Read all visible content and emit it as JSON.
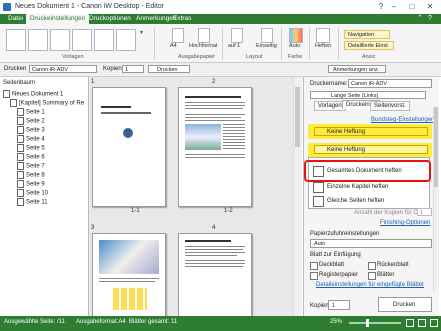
{
  "window": {
    "title": "Neues Dokument 1 - Canon iW Desktop - Editor"
  },
  "ribbon": {
    "tabs": [
      "Datei",
      "Druckeinstellungen",
      "Druckoptionen",
      "Anmerkungen",
      "Extras"
    ],
    "active_tab": "Druckeinstellungen",
    "groups": {
      "vorlagen": "Vorlagen",
      "ausgabepapier": "Ausgabepapier",
      "layout": "Layout",
      "farbe": "Farbe",
      "ansic": "Ansic"
    },
    "buttons": {
      "a4": "A4",
      "hochformat": "Hochformat",
      "auf1": "auf 1",
      "einseitig": "Einseitig",
      "auto": "Auto",
      "heften": "Heften",
      "navigation": "Navigation",
      "detaillierte_einst": "Detaillierte Einst"
    }
  },
  "toolbar": {
    "drucken_label": "Drucken",
    "printer": "Canon iR-ADV",
    "kopien_label": "Kopien",
    "kopien_value": "1",
    "drucken_button": "Drucken",
    "anmerkungen_button": "Anmerkungen anz."
  },
  "left_pane": {
    "header": "Seitenbaum",
    "root": "Neues Dokument 1",
    "chapter": "[Kapitel] Summary of Re",
    "pages": [
      "Seite 1",
      "Seite 2",
      "Seite 3",
      "Seite 4",
      "Seite 5",
      "Seite 6",
      "Seite 7",
      "Seite 8",
      "Seite 9",
      "Seite 10",
      "Seite 11"
    ]
  },
  "center": {
    "page_labels": [
      "1",
      "2",
      "3",
      "4"
    ],
    "spread_labels": [
      "1-1",
      "1-2"
    ]
  },
  "right_pane": {
    "druckername_label": "Druckername:",
    "druckername_value": "Canon iR-ADV",
    "top_combo": "Lange Seite (Links)",
    "tabs": [
      "Vorlagen",
      "Druckeinst.",
      "Seitenvorst."
    ],
    "active_tab": "Druckeinst.",
    "bundsteg_link": "Bundsteg-Einstellungen",
    "heften_combo_top": "Keine Heftung",
    "heften_combo": "Keine Heftung",
    "menu_items": [
      "Gesamtes Dokument heften",
      "Einzelne Kapitel heften",
      "Gleiche Seiten heften"
    ],
    "highlighted_item": "Gesamtes Dokument heften",
    "anzahl_label": "Anzahl der Kopien für Offset:",
    "anzahl_value": "1",
    "finishing_link": "Finishing-Optionen",
    "papierzufuhr_label": "Papierzufuhreinstellungen",
    "papierzufuhr_value": "Auto",
    "blatt_label": "Blatt zur Einfügung",
    "deckblatt": "Deckblatt",
    "rueckenblatt": "Rückenblatt",
    "registerpapier": "Registerpapier",
    "blatter": "Blätter",
    "detail_link": "Detaileinstellungen für eingefügte Blätter",
    "kopien_label": "Kopien:",
    "kopien_value": "1",
    "drucken_button": "Drucken"
  },
  "statusbar": {
    "ausgewahlte_seite": "Ausgewählte Seite: /11",
    "ausgabeformat": "Ausgabeformat:A4",
    "blatter_gesamt": "Blätter gesamt: 11",
    "zoom": "25%"
  },
  "colors": {
    "brand_green": "#2e7d32",
    "highlight_yellow": "#ffeb3b",
    "callout_red": "#e11"
  }
}
